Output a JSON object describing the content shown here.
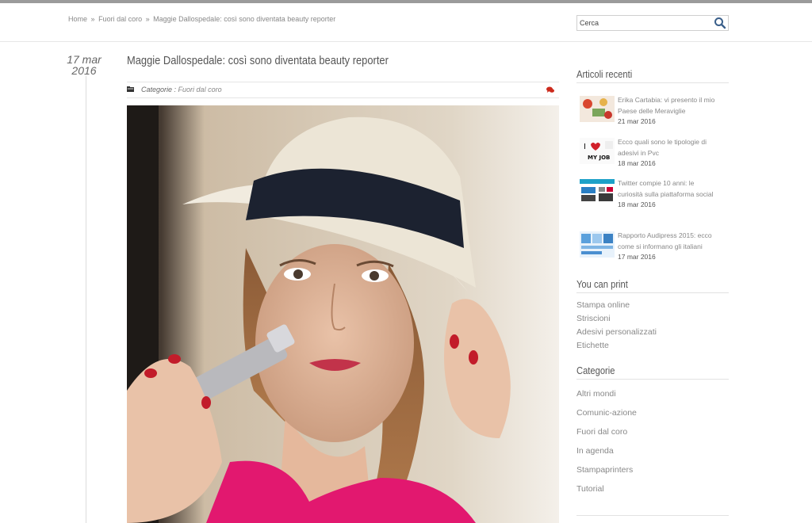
{
  "breadcrumb": {
    "home": "Home",
    "sep": "»",
    "category": "Fuori dal coro",
    "current": "Maggie Dallospedale: così sono diventata beauty reporter"
  },
  "search": {
    "placeholder": "Cerca",
    "icon": "search-icon"
  },
  "post": {
    "date_day": "17 mar",
    "date_year": "2016",
    "title": "Maggie Dallospedale: così sono diventata beauty reporter",
    "categories_label": "Categorie :",
    "category": "Fuori dal coro",
    "folder_icon": "folder-icon",
    "comment_icon": "comments-icon",
    "accent_color": "#cc2a1c"
  },
  "sidebar": {
    "recent_title": "Articoli recenti",
    "recent": [
      {
        "title": "Erika Cartabia: vi presento il mio Paese delle Meraviglie",
        "date": "21 mar 2016"
      },
      {
        "title": "Ecco quali sono le tipologie di adesivi in Pvc",
        "date": "18 mar 2016"
      },
      {
        "title": "Twitter compie 10 anni: le curiosità sulla piattaforma social",
        "date": "18 mar 2016"
      },
      {
        "title": "Rapporto Audipress 2015: ecco come si informano gli italiani",
        "date": "17 mar 2016"
      }
    ],
    "print_title": "You can print",
    "print_links": [
      "Stampa online",
      "Striscioni",
      "Adesivi personalizzati",
      "Etichette"
    ],
    "cat_title": "Categorie",
    "categories": [
      "Altri mondi",
      "Comunic-azione",
      "Fuori dal coro",
      "In agenda",
      "Stampaprinters",
      "Tutorial"
    ]
  }
}
